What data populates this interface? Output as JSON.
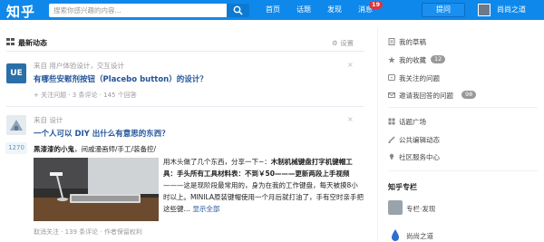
{
  "header": {
    "logo": "知乎",
    "search_placeholder": "搜索你感兴趣的内容...",
    "nav": [
      "首页",
      "话题",
      "发现",
      "消息"
    ],
    "message_count": "19",
    "ask_label": "提问",
    "user_name": "尚尚之道",
    "colors": {
      "bar": "#0f88eb",
      "badge": "#e0333e"
    }
  },
  "feed": {
    "title": "最新动态",
    "settings_label": "设置",
    "items": [
      {
        "avatar_text": "UE",
        "source_prefix": "来自",
        "source": "用户体验设计，交互设计",
        "title": "有哪些安慰剂按钮（Placebo button）的设计？",
        "close": "×",
        "actions": "+ 关注问题 · 3 条评论 · 145 个回答"
      },
      {
        "source_prefix": "来自",
        "source": "设计",
        "title": "一个人可以 DIY 出什么有意思的东西？",
        "close": "×",
        "votes": "1270",
        "author_name": "黑漆漆的小鬼",
        "author_bio": "，间戚漫画师/手工/装备控/",
        "excerpt_lead": "用木头做了几个东西，分享一下~：",
        "excerpt_bold1": "木制机械键盘打字机键帽工具：手头所有工具材料表：不到￥50———更新两段上手视频",
        "excerpt_tail": "———这是现阶段最常用的，身为在我的工作键盘，每天被摸8小时以上。MINILA原装键帽使用一个月后就打油了，手有空时亲手把这些键…",
        "more": "显示全部",
        "actions": "取消关注 · 139 条评论 · 作者保留权利"
      }
    ]
  },
  "sidebar": {
    "items": [
      {
        "label": "我的草稿",
        "icon": "draft-icon"
      },
      {
        "label": "我的收藏",
        "icon": "star-icon",
        "badge": "12"
      },
      {
        "label": "我关注的问题",
        "icon": "question-icon"
      },
      {
        "label": "邀请我回答的问题",
        "icon": "invite-icon",
        "badge": "98"
      }
    ],
    "items2": [
      {
        "label": "话题广场",
        "icon": "grid-icon"
      },
      {
        "label": "公共编辑动态",
        "icon": "edit-icon"
      },
      {
        "label": "社区服务中心",
        "icon": "community-icon"
      }
    ],
    "column_title": "知乎专栏",
    "columns": [
      {
        "label": "专栏·发现"
      },
      {
        "label": "尚尚之道"
      }
    ]
  }
}
